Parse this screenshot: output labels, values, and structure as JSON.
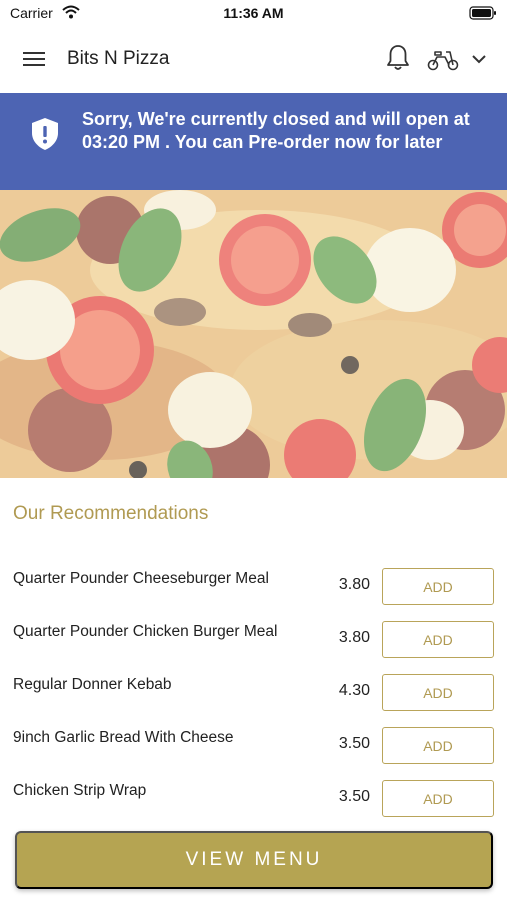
{
  "status_bar": {
    "carrier": "Carrier",
    "time": "11:36 AM"
  },
  "header": {
    "title": "Bits N Pizza",
    "icons": [
      "menu-icon",
      "bell-icon",
      "scooter-icon",
      "chevron-down-icon"
    ]
  },
  "banner": {
    "message": "Sorry, We're currently closed and will open at 03:20 PM . You can Pre-order now for later",
    "color": "#4d64b3",
    "icon": "shield-alert-icon"
  },
  "hero": {
    "image": "pizza-photo"
  },
  "recommendations": {
    "title": "Our Recommendations",
    "items": [
      {
        "name": "Quarter Pounder Cheeseburger Meal",
        "price": "3.80",
        "action": "ADD"
      },
      {
        "name": "Quarter Pounder Chicken Burger Meal",
        "price": "3.80",
        "action": "ADD"
      },
      {
        "name": "Regular Donner Kebab",
        "price": "4.30",
        "action": "ADD"
      },
      {
        "name": "9inch Garlic Bread With Cheese",
        "price": "3.50",
        "action": "ADD"
      },
      {
        "name": "Chicken Strip Wrap",
        "price": "3.50",
        "action": "ADD"
      }
    ]
  },
  "footer": {
    "view_menu_label": "VIEW MENU",
    "accent_color": "#b5a452"
  }
}
